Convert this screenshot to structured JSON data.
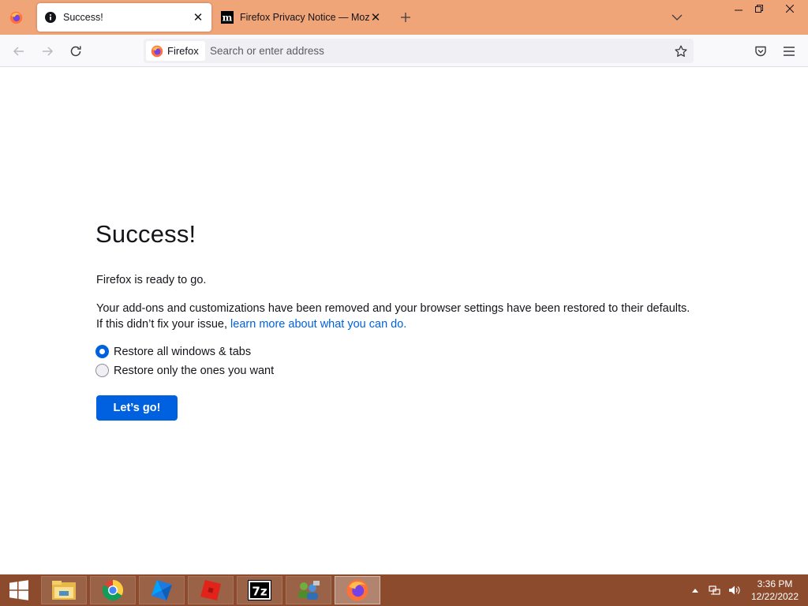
{
  "browser": {
    "tabs": [
      {
        "title": "Success!",
        "favicon": "info-icon",
        "active": true
      },
      {
        "title": "Firefox Privacy Notice — Mozilla",
        "favicon": "mozilla-m-icon",
        "active": false
      }
    ],
    "urlbar": {
      "identity_label": "Firefox",
      "placeholder": "Search or enter address"
    }
  },
  "page": {
    "title": "Success!",
    "intro": "Firefox is ready to go.",
    "description": "Your add-ons and customizations have been removed and your browser settings have been restored to their defaults.",
    "help_prefix": "If this didn’t fix your issue,",
    "help_link": "learn more about what you can do.",
    "options": [
      {
        "label": "Restore all windows & tabs",
        "checked": true
      },
      {
        "label": "Restore only the ones you want",
        "checked": false
      }
    ],
    "button_label": "Let’s go!"
  },
  "taskbar": {
    "apps": [
      "file-explorer-icon",
      "chrome-icon",
      "roblox-studio-icon",
      "roblox-icon",
      "7zip-icon",
      "network-manager-icon",
      "firefox-icon"
    ],
    "active_app": "firefox-icon",
    "time": "3:36 PM",
    "date": "12/22/2022"
  },
  "colors": {
    "tabstrip": "#f0a578",
    "accent": "#0061e0",
    "taskbar": "#8c4b2c"
  }
}
